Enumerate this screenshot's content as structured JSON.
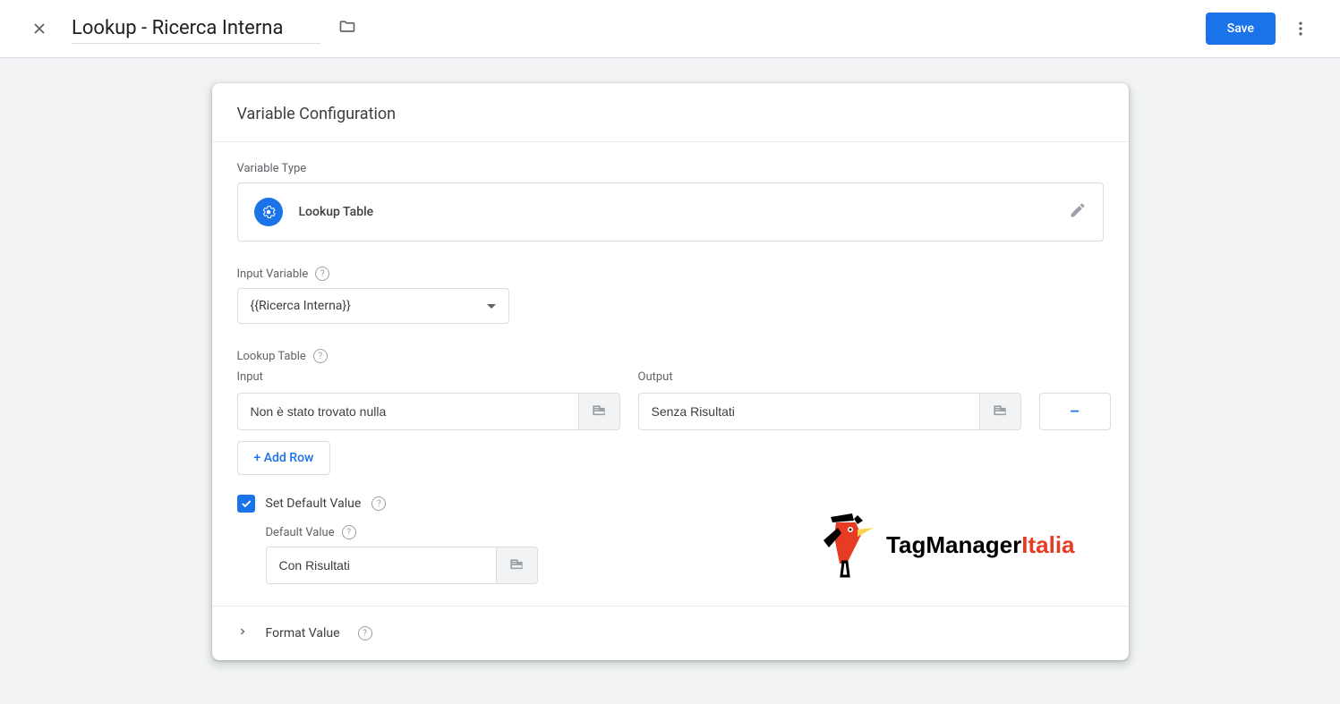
{
  "header": {
    "title": "Lookup - Ricerca Interna",
    "save_label": "Save"
  },
  "card": {
    "title": "Variable Configuration",
    "variable_type_label": "Variable Type",
    "variable_type_value": "Lookup Table",
    "input_variable_label": "Input Variable",
    "input_variable_value": "{{Ricerca Interna}}",
    "lookup_table_label": "Lookup Table",
    "input_col": "Input",
    "output_col": "Output",
    "rows": [
      {
        "input": "Non è stato trovato nulla",
        "output": "Senza Risultati"
      }
    ],
    "add_row_label": "+ Add Row",
    "set_default_label": "Set Default Value",
    "default_value_label": "Default Value",
    "default_value": "Con Risultati",
    "format_value_label": "Format Value",
    "remove_symbol": "–"
  },
  "logo": {
    "part1": "TagManager",
    "part2": "Italia"
  }
}
